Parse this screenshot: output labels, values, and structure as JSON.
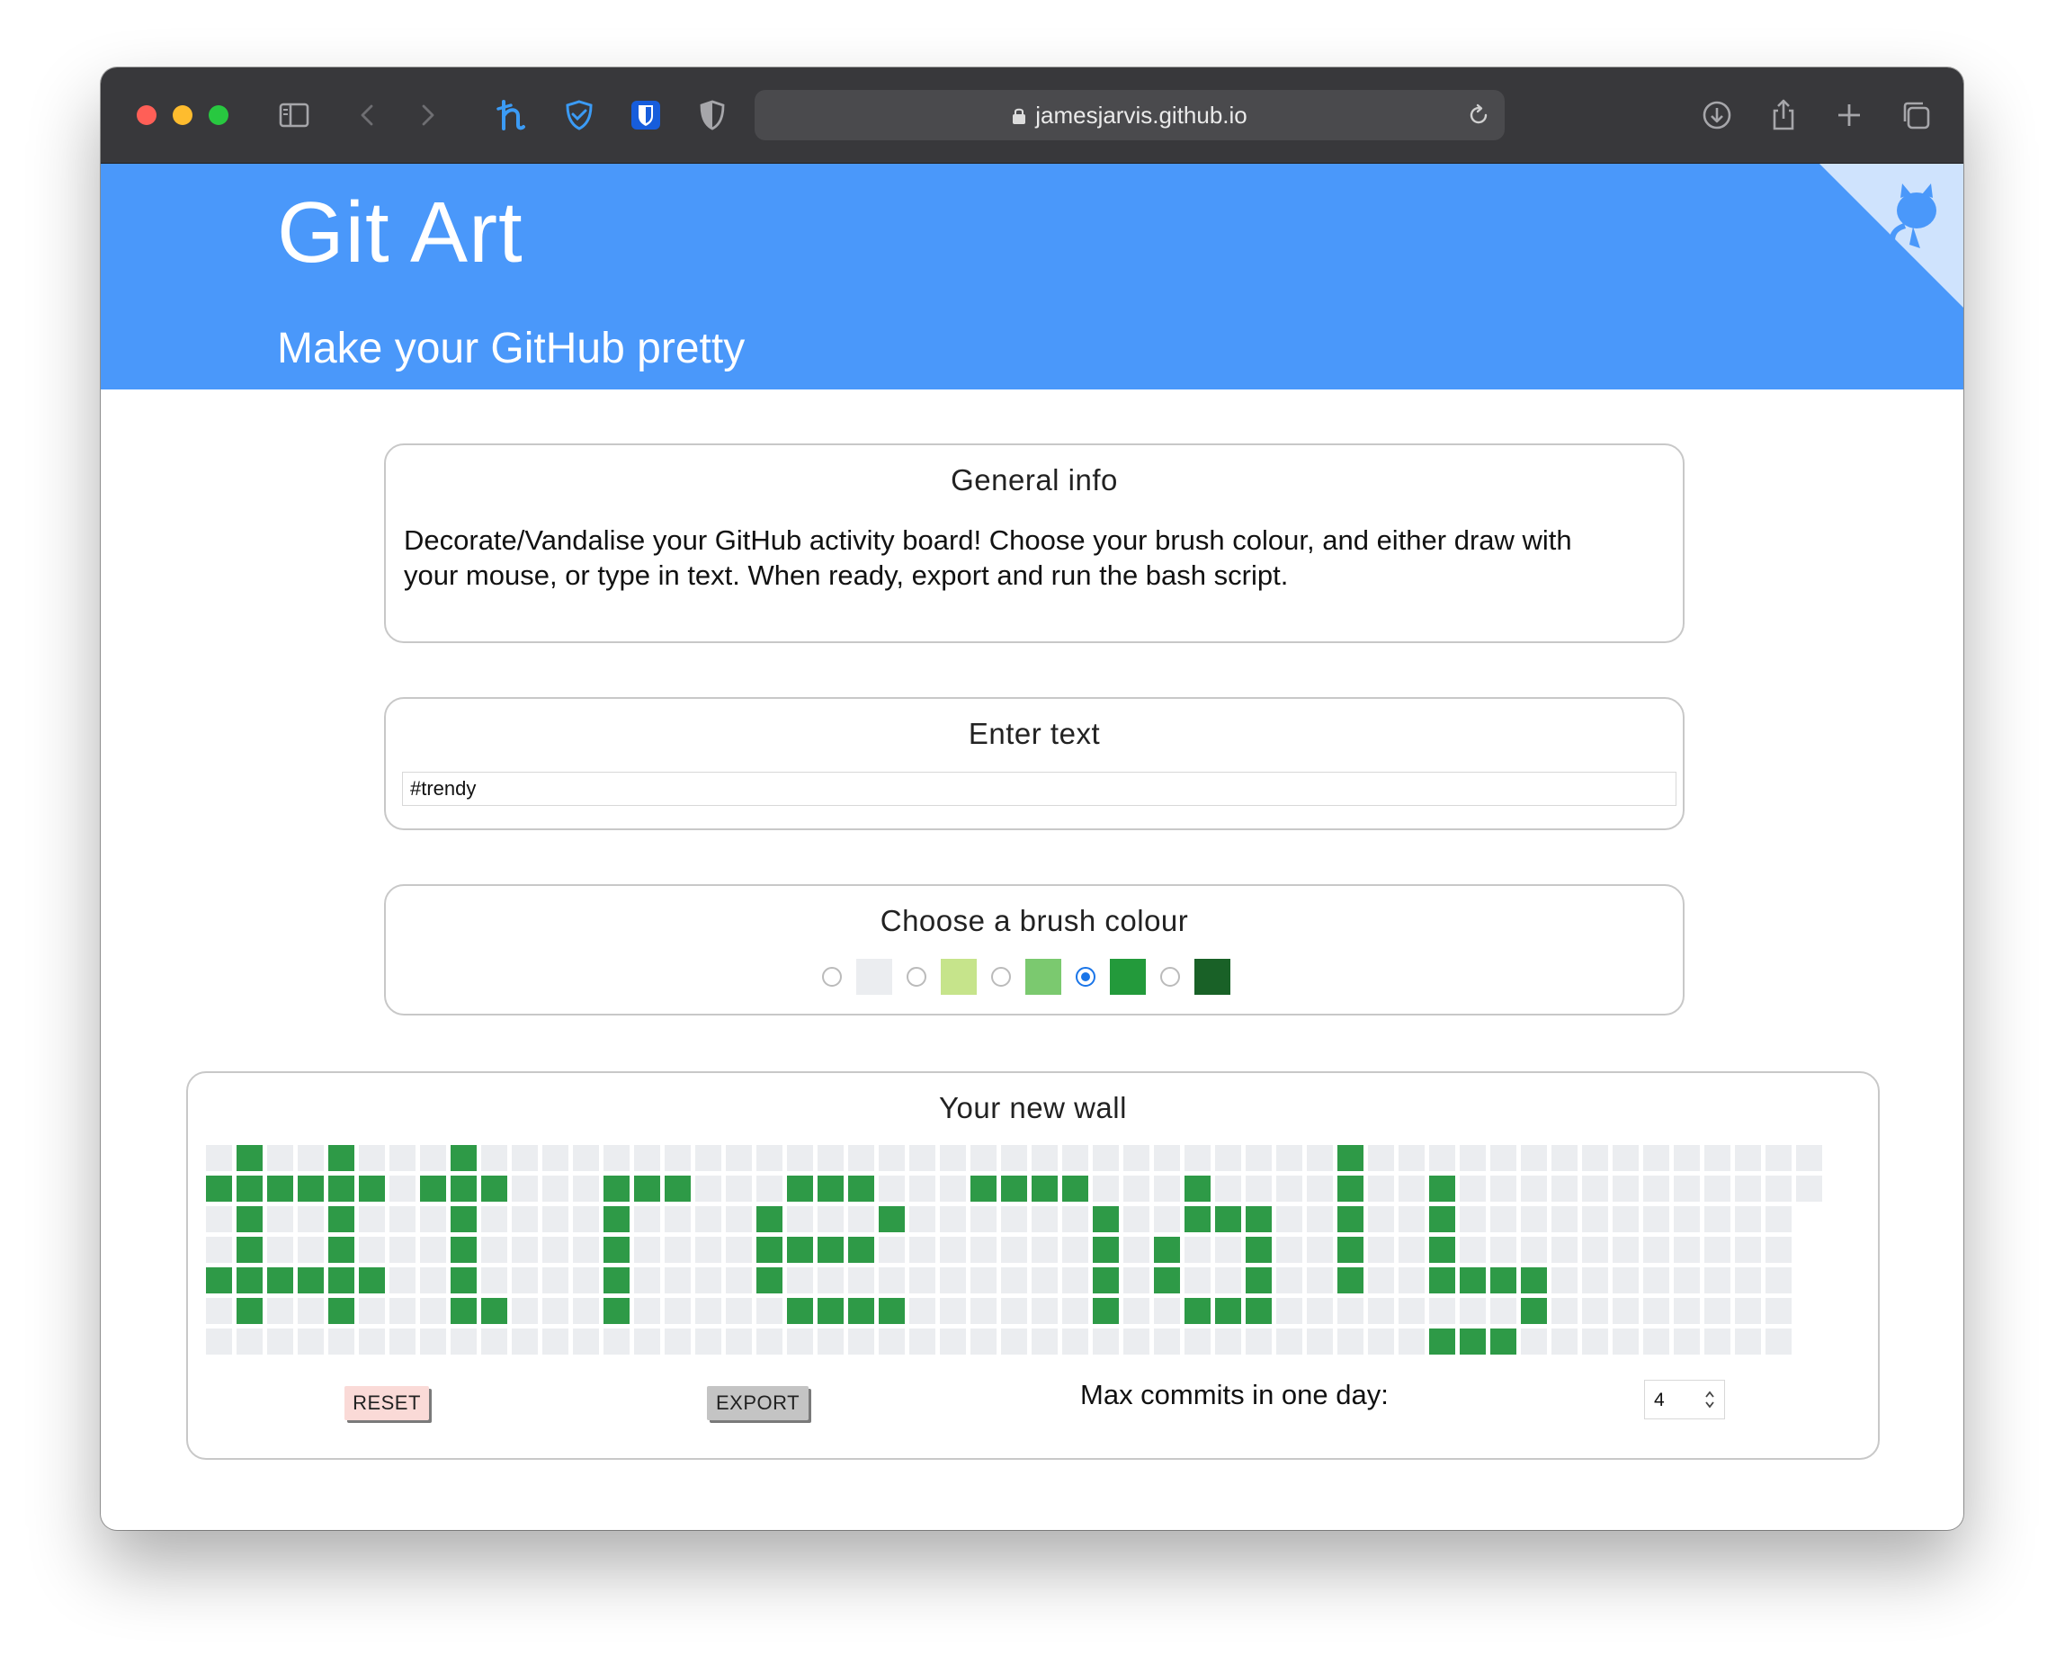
{
  "browser": {
    "url": "jamesjarvis.github.io",
    "toolbar_icons": [
      "sidebar-icon",
      "back-icon",
      "forward-icon",
      "honey-extension-icon",
      "shield-check-extension-icon",
      "bitwarden-extension-icon",
      "privacy-shield-icon",
      "download-icon",
      "share-icon",
      "new-tab-icon",
      "tab-overview-icon"
    ]
  },
  "header": {
    "title": "Git Art",
    "subtitle": "Make your GitHub pretty",
    "corner_icon": "github-octocat-icon"
  },
  "general_info": {
    "title": "General info",
    "text": "Decorate/Vandalise your GitHub activity board! Choose your brush colour, and either draw with your mouse, or type in text. When ready, export and run the bash script."
  },
  "enter_text": {
    "title": "Enter text",
    "value": "#trendy"
  },
  "brush": {
    "title": "Choose a brush colour",
    "colors": [
      "#ebedf0",
      "#c6e48b",
      "#7bc96f",
      "#239a3b",
      "#196127"
    ],
    "selected_index": 3
  },
  "wall": {
    "title": "Your new wall",
    "empty_color": "#ebedf0",
    "paint_color": "#2e9a47",
    "columns": 53,
    "rows": 7,
    "last_column_rows": 2,
    "painted": [
      [
        1,
        0
      ],
      [
        1,
        1
      ],
      [
        1,
        2
      ],
      [
        1,
        3
      ],
      [
        1,
        4
      ],
      [
        1,
        5
      ],
      [
        1,
        6
      ],
      [
        1,
        7
      ],
      [
        1,
        8
      ],
      [
        1,
        9
      ],
      [
        1,
        10
      ],
      [
        1,
        11
      ],
      [
        1,
        12
      ],
      [
        1,
        13
      ],
      [
        1,
        14
      ],
      [
        1,
        15
      ],
      [
        1,
        16
      ],
      [
        1,
        17
      ],
      [
        1,
        18
      ],
      [
        1,
        19
      ],
      [
        1,
        20
      ],
      [
        1,
        21
      ],
      [
        1,
        22
      ],
      [
        1,
        23
      ],
      [
        1,
        24
      ],
      [
        1,
        25
      ],
      [
        1,
        26
      ],
      [
        1,
        27
      ],
      [
        1,
        28
      ],
      [
        1,
        29
      ],
      [
        1,
        30
      ],
      [
        1,
        31
      ],
      [
        1,
        32
      ],
      [
        1,
        33
      ],
      [
        1,
        34
      ],
      [
        1,
        35
      ],
      [
        1,
        36
      ],
      [
        1,
        37
      ],
      [
        1,
        38
      ],
      [
        1,
        39
      ],
      [
        1,
        40
      ],
      [
        1,
        41
      ],
      [
        1,
        42
      ],
      [
        1,
        43
      ],
      [
        1,
        44
      ],
      [
        1,
        45
      ],
      [
        1,
        46
      ],
      [
        1,
        47
      ],
      [
        1,
        48
      ],
      [
        1,
        49
      ],
      [
        1,
        50
      ],
      [
        1,
        51
      ],
      [
        1,
        52
      ]
    ],
    "pattern_rows": [
      "0100100010000000000000000000000000000100000000000000000",
      "1111110111000111000111000111100010000100100000000000000",
      "0100100010000100001000100000010011100100100000000000000",
      "0100100010000100001111000000010100100100100000000000000",
      "1111110010000100001000000000010100100100111100000000000",
      "0100100011000100000111100000010011100000000100000000000",
      "0000000000000000000000000000000000000000111000000000000"
    ],
    "reset_label": "RESET",
    "export_label": "EXPORT",
    "max_commits_label": "Max commits in one day:",
    "max_commits_value": "4"
  }
}
